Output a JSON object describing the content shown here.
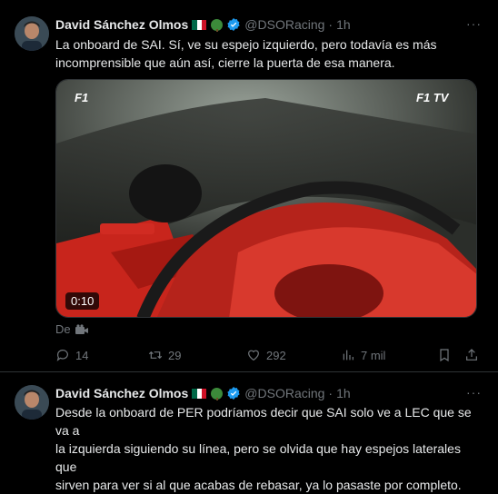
{
  "tweets": [
    {
      "author_name": "David Sánchez Olmos",
      "handle": "@DSORacing",
      "separator": "·",
      "time": "1h",
      "text_line1": "La onboard de SAI. Sí, ve su espejo izquierdo, pero todavía es más",
      "text_line2": "incomprensible que aún así, cierre la puerta de esa manera.",
      "video": {
        "duration": "0:10",
        "logo_left": "F1",
        "logo_right": "F1 TV"
      },
      "source_label": "De",
      "actions": {
        "replies": "14",
        "retweets": "29",
        "likes": "292",
        "views": "7 mil"
      }
    },
    {
      "author_name": "David Sánchez Olmos",
      "handle": "@DSORacing",
      "separator": "·",
      "time": "1h",
      "text_line1": "Desde la onboard de PER podríamos decir que SAI solo ve a LEC que se va a",
      "text_line2": "la izquierda siguiendo su línea, pero se olvida que hay espejos laterales que",
      "text_line3": "sirven para ver si al que acabas de rebasar, ya lo pasaste por completo."
    }
  ],
  "colors": {
    "background": "#000000",
    "text": "#e7e9ea",
    "muted": "#71767b",
    "verified": "#1d9bf0",
    "divider": "#2f3336"
  },
  "icons": [
    "verified-badge-icon",
    "mexico-flag-icon",
    "tree-emoji-icon",
    "more-icon",
    "reply-icon",
    "retweet-icon",
    "like-icon",
    "views-icon",
    "bookmark-icon",
    "share-icon",
    "camera-icon"
  ]
}
